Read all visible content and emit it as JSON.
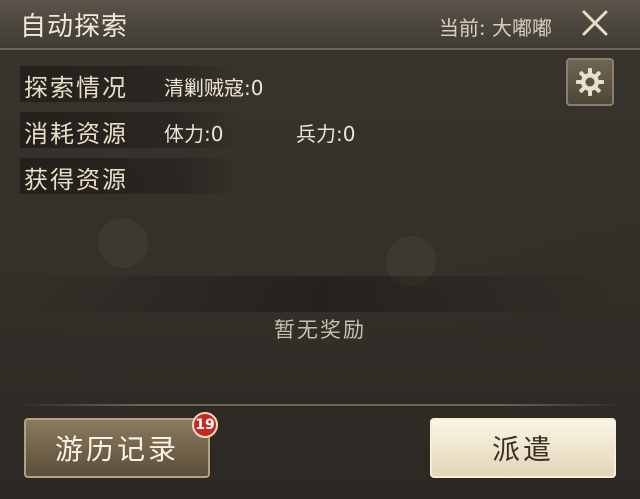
{
  "header": {
    "title": "自动探索",
    "current_label": "当前: 大嘟嘟"
  },
  "rows": {
    "explore_status": {
      "label": "探索情况",
      "bandits_label": "清剿贼寇:",
      "bandits_value": "0"
    },
    "consume": {
      "label": "消耗资源",
      "stamina_label": "体力:",
      "stamina_value": "0",
      "troops_label": "兵力:",
      "troops_value": "0"
    },
    "obtain": {
      "label": "获得资源"
    }
  },
  "rewards": {
    "empty_text": "暂无奖励"
  },
  "footer": {
    "log_label": "游历记录",
    "log_badge": "19",
    "dispatch_label": "派遣"
  },
  "icons": {
    "close": "close-icon",
    "settings": "gear-icon"
  },
  "colors": {
    "badge": "#c22a22",
    "dispatch_bg": "#f0e6cf",
    "log_bg": "#7a6a50"
  }
}
